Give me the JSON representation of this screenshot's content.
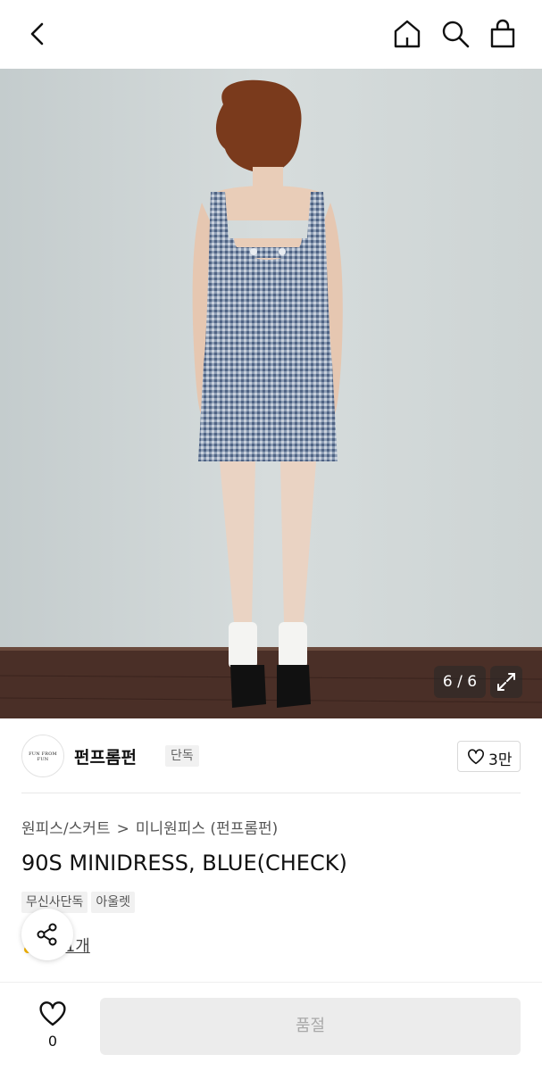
{
  "header": {
    "icons": [
      "chevron-left-icon",
      "home-icon",
      "search-icon",
      "shopping-bag-icon"
    ]
  },
  "gallery": {
    "counter": "6 / 6",
    "current_image": 6,
    "total_images": 6,
    "expand_icon": "expand-icon"
  },
  "brand": {
    "logo_text": "FUN FROM FUN",
    "name": "펀프롬펀",
    "badge": "단독",
    "likes": "3만"
  },
  "product": {
    "breadcrumb": [
      "원피스/스커트",
      "미니원피스 (펀프롬펀)"
    ],
    "breadcrumb_separator": ">",
    "title": "90S MINIDRESS, BLUE(CHECK)",
    "tags": [
      "무신사단독",
      "아울렛"
    ],
    "review_link": "후기 1개"
  },
  "bottom_bar": {
    "wishlist_count": "0",
    "buy_button": "품절"
  },
  "colors": {
    "wall": "#cfd6d6",
    "floor": "#4a2f27",
    "dress": "#7d8ea8",
    "soldout_bg": "#ececec",
    "soldout_text": "#a9a9a9"
  }
}
